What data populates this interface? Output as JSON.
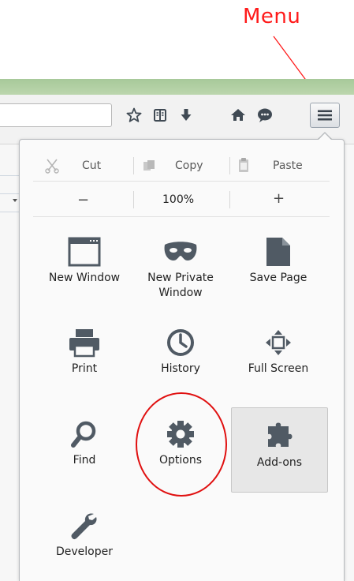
{
  "annotation": {
    "label": "Menu"
  },
  "toolbar": {
    "icons": [
      "star-icon",
      "reading-list-icon",
      "download-icon",
      "home-icon",
      "chat-icon"
    ],
    "menu_button_icon": "hamburger-icon"
  },
  "edit_row": {
    "cut": "Cut",
    "copy": "Copy",
    "paste": "Paste"
  },
  "zoom_row": {
    "minus": "−",
    "level": "100%",
    "plus": "+"
  },
  "items": [
    {
      "label": "New Window",
      "icon": "window-icon"
    },
    {
      "label": "New Private\nWindow",
      "icon": "mask-icon"
    },
    {
      "label": "Save Page",
      "icon": "page-icon"
    },
    {
      "label": "Print",
      "icon": "printer-icon"
    },
    {
      "label": "History",
      "icon": "clock-icon"
    },
    {
      "label": "Full Screen",
      "icon": "fullscreen-icon"
    },
    {
      "label": "Find",
      "icon": "magnifier-icon"
    },
    {
      "label": "Options",
      "icon": "gear-icon"
    },
    {
      "label": "Add-ons",
      "icon": "puzzle-icon"
    },
    {
      "label": "Developer",
      "icon": "wrench-icon"
    }
  ],
  "colors": {
    "annotation": "#ff1a1a",
    "icon": "#505a64",
    "titlebar": "#a7c99a"
  }
}
